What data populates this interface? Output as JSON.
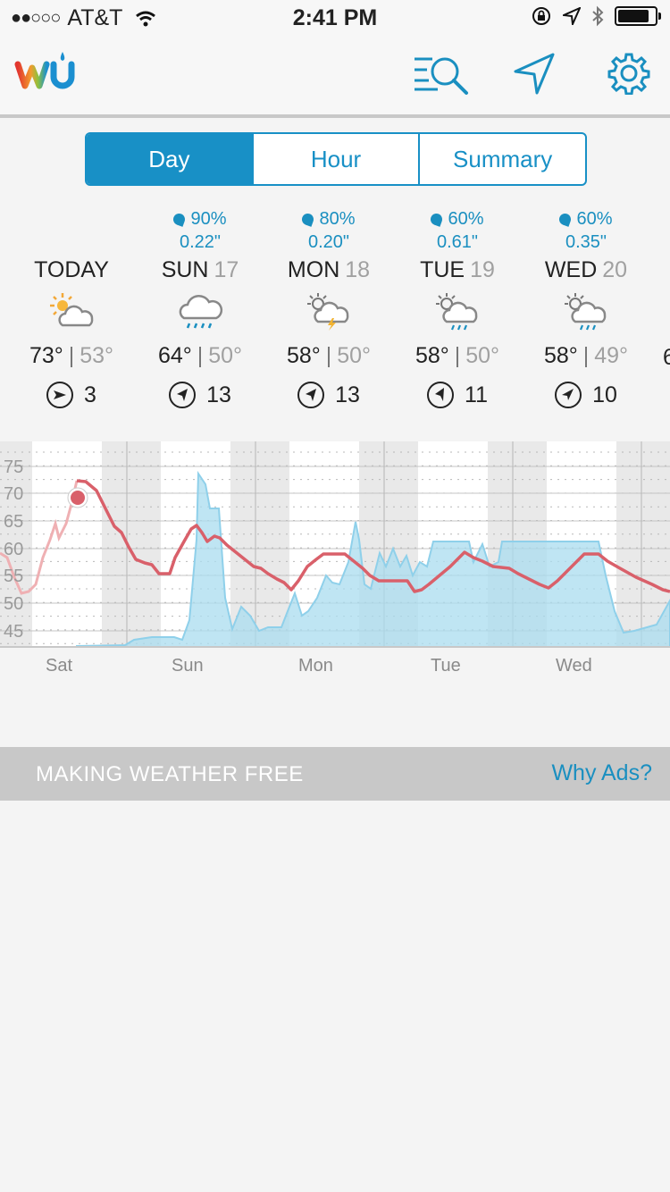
{
  "status_bar": {
    "signal": "●●○○○",
    "carrier": "AT&T",
    "time": "2:41 PM"
  },
  "header": {
    "logo_text": "wu",
    "icons": [
      "search-list-icon",
      "location-arrow-icon",
      "gear-icon"
    ]
  },
  "tabs": [
    {
      "label": "Day",
      "active": true
    },
    {
      "label": "Hour",
      "active": false
    },
    {
      "label": "Summary",
      "active": false
    }
  ],
  "forecast": [
    {
      "day": "TODAY",
      "date": "",
      "chance": "",
      "amount": "",
      "icon": "partly-cloudy-icon",
      "high": "73°",
      "low": "53°",
      "wind": "3"
    },
    {
      "day": "SUN",
      "date": "17",
      "chance": "90%",
      "amount": "0.22\"",
      "icon": "rain-icon",
      "high": "64°",
      "low": "50°",
      "wind": "13"
    },
    {
      "day": "MON",
      "date": "18",
      "chance": "80%",
      "amount": "0.20\"",
      "icon": "thunderstorm-icon",
      "high": "58°",
      "low": "50°",
      "wind": "13"
    },
    {
      "day": "TUE",
      "date": "19",
      "chance": "60%",
      "amount": "0.61\"",
      "icon": "partly-cloudy-rain-icon",
      "high": "58°",
      "low": "50°",
      "wind": "11"
    },
    {
      "day": "WED",
      "date": "20",
      "chance": "60%",
      "amount": "0.35\"",
      "icon": "partly-cloudy-rain-icon",
      "high": "58°",
      "low": "49°",
      "wind": "10"
    }
  ],
  "next_high_partial": "6",
  "chart_data": {
    "type": "line",
    "y_ticks": [
      "75",
      "70",
      "65",
      "60",
      "55",
      "50",
      "45"
    ],
    "x_labels": [
      "Sat",
      "Sun",
      "Mon",
      "Tue",
      "Wed"
    ],
    "temperature_color": "#d9606a",
    "precip_color": "#a9dcef"
  },
  "ad": {
    "text": "MAKING WEATHER FREE",
    "link": "Why Ads?"
  }
}
